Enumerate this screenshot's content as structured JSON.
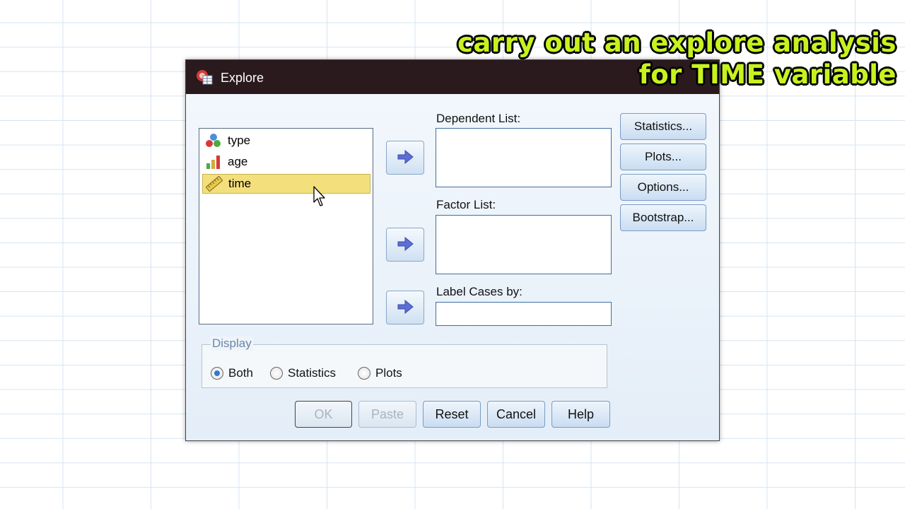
{
  "caption": {
    "line1": "carry out an explore analysis",
    "line2": "for TIME variable",
    "color": "#c8f21e"
  },
  "dialog": {
    "title": "Explore",
    "title_icon": "spss-dialog-icon",
    "variables": [
      {
        "name": "type",
        "icon": "nominal-icon",
        "selected": false
      },
      {
        "name": "age",
        "icon": "ordinal-icon",
        "selected": false
      },
      {
        "name": "time",
        "icon": "scale-ruler-icon",
        "selected": true
      }
    ],
    "dependent_list_label": "Dependent List:",
    "factor_list_label": "Factor List:",
    "label_cases_label": "Label Cases by:",
    "side_buttons": {
      "statistics": "Statistics...",
      "plots": "Plots...",
      "options": "Options...",
      "bootstrap": "Bootstrap..."
    },
    "display": {
      "legend": "Display",
      "options": [
        {
          "label": "Both",
          "checked": true
        },
        {
          "label": "Statistics",
          "checked": false
        },
        {
          "label": "Plots",
          "checked": false
        }
      ]
    },
    "buttons": {
      "ok": "OK",
      "paste": "Paste",
      "reset": "Reset",
      "cancel": "Cancel",
      "help": "Help"
    },
    "colors": {
      "selection": "#f3e07d",
      "titlebar": "#2a1a1e",
      "arrow": "#5b6fd6"
    }
  }
}
